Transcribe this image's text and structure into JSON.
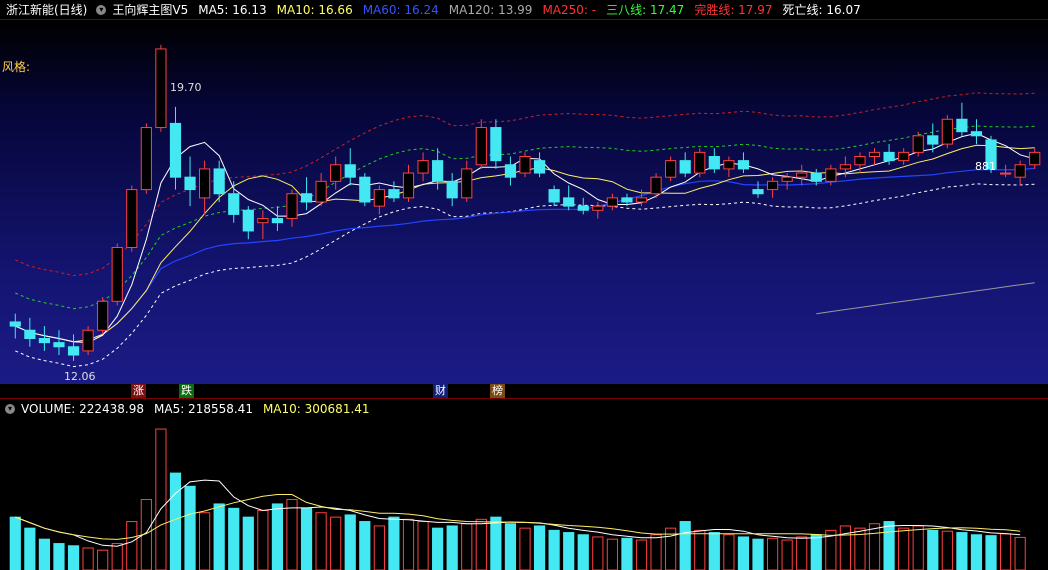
{
  "header": {
    "stock_name": "浙江新能(日线)",
    "indicator_name": "王向辉主图V5",
    "items": [
      {
        "label": "MA5: 16.13",
        "color": "#ffffff"
      },
      {
        "label": "MA10: 16.66",
        "color": "#ffff66"
      },
      {
        "label": "MA60: 16.24",
        "color": "#3355ff"
      },
      {
        "label": "MA120: 13.99",
        "color": "#aaaaaa"
      },
      {
        "label": "MA250: -",
        "color": "#ff3333"
      },
      {
        "label": "三八线: 17.47",
        "color": "#33ff33"
      },
      {
        "label": "完胜线: 17.97",
        "color": "#ff3333"
      },
      {
        "label": "死亡线: 16.07",
        "color": "#ffffff"
      }
    ]
  },
  "style_label": "风格:",
  "high_label": "19.70",
  "low_label": "12.06",
  "hand_label": "881",
  "events": [
    {
      "label": "涨",
      "bg": "#7a1010",
      "color": "#ffffff",
      "col": 0.125
    },
    {
      "label": "跌",
      "bg": "#0d6b10",
      "color": "#ffffff",
      "col": 0.171
    },
    {
      "label": "财",
      "bg": "#10207a",
      "color": "#ffffff",
      "col": 0.413
    },
    {
      "label": "榜",
      "bg": "#7a4a10",
      "color": "#ffffff",
      "col": 0.468
    }
  ],
  "volume_header": {
    "items": [
      {
        "label": "VOLUME: 222438.98",
        "color": "#ffffff"
      },
      {
        "label": "MA5: 218558.41",
        "color": "#ffffff"
      },
      {
        "label": "MA10: 300681.41",
        "color": "#ffff66"
      }
    ]
  },
  "chart_data": {
    "type": "candlestick",
    "price_range": [
      11.5,
      20.3
    ],
    "candles": [
      [
        13.0,
        13.2,
        12.6,
        12.9
      ],
      [
        12.8,
        13.1,
        12.4,
        12.6
      ],
      [
        12.6,
        12.9,
        12.3,
        12.5
      ],
      [
        12.5,
        12.8,
        12.2,
        12.4
      ],
      [
        12.4,
        12.7,
        12.06,
        12.2
      ],
      [
        12.3,
        12.9,
        12.2,
        12.8
      ],
      [
        12.8,
        13.6,
        12.7,
        13.5
      ],
      [
        13.5,
        14.9,
        13.4,
        14.8
      ],
      [
        14.8,
        16.3,
        14.7,
        16.2
      ],
      [
        16.2,
        17.8,
        16.1,
        17.7
      ],
      [
        17.7,
        19.7,
        17.6,
        19.6
      ],
      [
        17.8,
        18.2,
        16.2,
        16.5
      ],
      [
        16.5,
        17.0,
        15.8,
        16.2
      ],
      [
        16.0,
        16.9,
        15.6,
        16.7
      ],
      [
        16.7,
        16.9,
        15.9,
        16.1
      ],
      [
        16.1,
        16.4,
        15.4,
        15.6
      ],
      [
        15.7,
        15.8,
        15.0,
        15.2
      ],
      [
        15.4,
        15.7,
        15.0,
        15.5
      ],
      [
        15.5,
        15.8,
        15.2,
        15.4
      ],
      [
        15.5,
        16.2,
        15.3,
        16.1
      ],
      [
        16.1,
        16.5,
        15.7,
        15.9
      ],
      [
        15.9,
        16.6,
        15.8,
        16.4
      ],
      [
        16.4,
        17.0,
        16.2,
        16.8
      ],
      [
        16.8,
        17.2,
        16.3,
        16.5
      ],
      [
        16.5,
        16.6,
        15.8,
        15.9
      ],
      [
        15.8,
        16.3,
        15.6,
        16.2
      ],
      [
        16.2,
        16.4,
        15.9,
        16.0
      ],
      [
        16.0,
        16.8,
        15.9,
        16.6
      ],
      [
        16.6,
        17.1,
        16.4,
        16.9
      ],
      [
        16.9,
        17.2,
        16.2,
        16.4
      ],
      [
        16.4,
        16.6,
        15.8,
        16.0
      ],
      [
        16.0,
        16.9,
        15.9,
        16.7
      ],
      [
        16.8,
        17.9,
        16.7,
        17.7
      ],
      [
        17.7,
        17.9,
        16.7,
        16.9
      ],
      [
        16.8,
        17.0,
        16.3,
        16.5
      ],
      [
        16.6,
        17.1,
        16.5,
        17.0
      ],
      [
        16.9,
        17.1,
        16.5,
        16.6
      ],
      [
        16.2,
        16.3,
        15.8,
        15.9
      ],
      [
        16.0,
        16.3,
        15.7,
        15.8
      ],
      [
        15.8,
        16.0,
        15.6,
        15.7
      ],
      [
        15.7,
        15.9,
        15.5,
        15.8
      ],
      [
        15.8,
        16.1,
        15.7,
        16.0
      ],
      [
        16.0,
        16.1,
        15.8,
        15.9
      ],
      [
        15.9,
        16.2,
        15.8,
        16.0
      ],
      [
        16.1,
        16.6,
        16.0,
        16.5
      ],
      [
        16.5,
        17.0,
        16.4,
        16.9
      ],
      [
        16.9,
        17.1,
        16.5,
        16.6
      ],
      [
        16.6,
        17.2,
        16.5,
        17.1
      ],
      [
        17.0,
        17.2,
        16.6,
        16.7
      ],
      [
        16.7,
        17.0,
        16.5,
        16.9
      ],
      [
        16.9,
        17.1,
        16.6,
        16.7
      ],
      [
        16.2,
        16.4,
        16.0,
        16.1
      ],
      [
        16.2,
        16.5,
        16.0,
        16.4
      ],
      [
        16.4,
        16.6,
        16.2,
        16.5
      ],
      [
        16.5,
        16.8,
        16.3,
        16.6
      ],
      [
        16.6,
        16.7,
        16.3,
        16.4
      ],
      [
        16.4,
        16.8,
        16.3,
        16.7
      ],
      [
        16.7,
        17.0,
        16.5,
        16.8
      ],
      [
        16.8,
        17.1,
        16.6,
        17.0
      ],
      [
        17.0,
        17.2,
        16.8,
        17.1
      ],
      [
        17.1,
        17.3,
        16.8,
        16.9
      ],
      [
        16.9,
        17.2,
        16.8,
        17.1
      ],
      [
        17.1,
        17.6,
        17.0,
        17.5
      ],
      [
        17.5,
        17.8,
        17.1,
        17.3
      ],
      [
        17.3,
        18.0,
        17.2,
        17.9
      ],
      [
        17.9,
        18.3,
        17.5,
        17.6
      ],
      [
        17.6,
        17.9,
        17.3,
        17.5
      ],
      [
        17.4,
        17.5,
        16.6,
        16.7
      ],
      [
        16.6,
        16.8,
        16.5,
        16.6
      ],
      [
        16.5,
        16.9,
        16.3,
        16.8
      ],
      [
        16.8,
        17.2,
        16.7,
        17.1
      ]
    ],
    "volumes": [
      120,
      95,
      70,
      60,
      55,
      50,
      45,
      60,
      110,
      160,
      320,
      220,
      190,
      130,
      150,
      140,
      120,
      135,
      150,
      160,
      140,
      130,
      120,
      125,
      110,
      100,
      120,
      115,
      110,
      95,
      100,
      105,
      115,
      120,
      105,
      95,
      100,
      90,
      85,
      80,
      75,
      70,
      72,
      68,
      80,
      95,
      110,
      90,
      85,
      80,
      75,
      70,
      72,
      68,
      75,
      80,
      90,
      100,
      95,
      105,
      110,
      95,
      100,
      90,
      88,
      85,
      80,
      78,
      82,
      74
    ]
  }
}
